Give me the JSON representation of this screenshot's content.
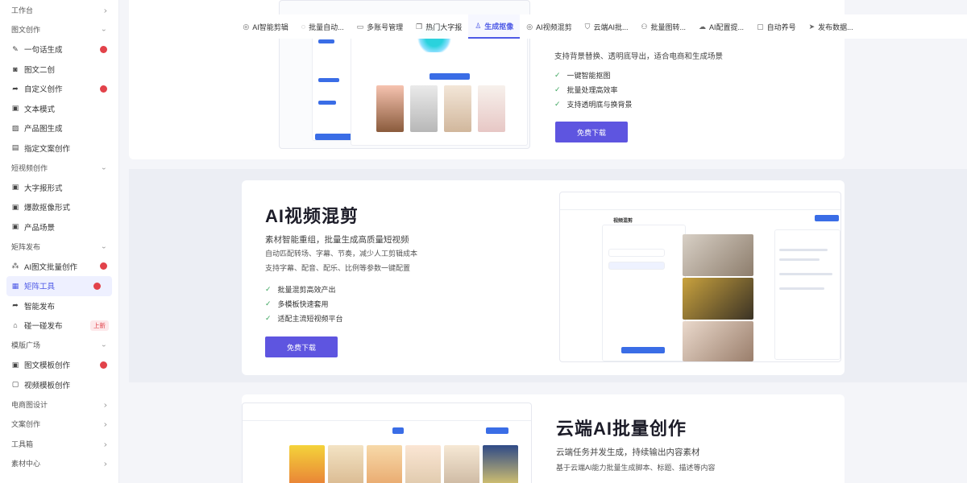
{
  "sidebar": {
    "sections": [
      {
        "label": "工作台",
        "items": []
      },
      {
        "label": "图文创作",
        "items": [
          {
            "label": "一句话生成",
            "icon": "pen-icon",
            "dot": true
          },
          {
            "label": "图文二创",
            "icon": "camera-icon",
            "dot": false
          },
          {
            "label": "自定义创作",
            "icon": "share-icon",
            "dot": true
          },
          {
            "label": "文本模式",
            "icon": "doc-icon",
            "dot": false
          },
          {
            "label": "产品图生成",
            "icon": "image-icon",
            "dot": false
          },
          {
            "label": "指定文案创作",
            "icon": "file-icon",
            "dot": false
          }
        ]
      },
      {
        "label": "短视频创作",
        "items": [
          {
            "label": "大字报形式",
            "icon": "doc-icon",
            "dot": false
          },
          {
            "label": "爆款抠像形式",
            "icon": "doc-icon",
            "dot": false
          },
          {
            "label": "产品场景",
            "icon": "doc-icon",
            "dot": false
          }
        ]
      },
      {
        "label": "矩阵发布",
        "items": [
          {
            "label": "AI图文批量创作",
            "icon": "tree-icon",
            "dot": true
          },
          {
            "label": "矩阵工具",
            "icon": "grid-icon",
            "dot": true,
            "active": true
          },
          {
            "label": "智能发布",
            "icon": "share-icon",
            "dot": false
          },
          {
            "label": "碰一碰发布",
            "icon": "home-icon",
            "badge": "上新"
          }
        ]
      },
      {
        "label": "模版广场",
        "items": [
          {
            "label": "图文模板创作",
            "icon": "doc-icon",
            "dot": true
          },
          {
            "label": "视频模板创作",
            "icon": "video-icon",
            "dot": false
          }
        ]
      },
      {
        "label": "电商图设计",
        "items": []
      },
      {
        "label": "文案创作",
        "items": []
      },
      {
        "label": "工具箱",
        "items": []
      },
      {
        "label": "素材中心",
        "items": []
      }
    ]
  },
  "tabs": [
    {
      "label": "AI智能剪辑",
      "icon": "check-circle-icon"
    },
    {
      "label": "批量自动...",
      "icon": "chat-icon"
    },
    {
      "label": "多账号管理",
      "icon": "monitor-icon"
    },
    {
      "label": "热门大字报",
      "icon": "copy-icon"
    },
    {
      "label": "生成抠像",
      "icon": "user-icon",
      "active": true
    },
    {
      "label": "AI视频混剪",
      "icon": "check-circle-icon"
    },
    {
      "label": "云端AI批...",
      "icon": "shield-icon"
    },
    {
      "label": "批量图转...",
      "icon": "nodes-icon"
    },
    {
      "label": "AI配置提...",
      "icon": "cloud-icon"
    },
    {
      "label": "自动养号",
      "icon": "box-icon"
    },
    {
      "label": "发布数据...",
      "icon": "send-icon"
    }
  ],
  "feature_top": {
    "subtitle": "支持背景替换、透明底导出，适合电商和生成场景",
    "list": [
      "一键智能抠图",
      "批量处理高效率",
      "支持透明底与换背景"
    ],
    "button": "免费下载"
  },
  "feature_mix": {
    "title": "AI视频混剪",
    "subtitle": "素材智能重组，批量生成高质量短视频",
    "desc": [
      "自动匹配转场、字幕、节奏，减少人工剪辑成本",
      "支持字幕、配音、配乐、比例等参数一键配置"
    ],
    "list": [
      "批量混剪高效产出",
      "多模板快速套用",
      "适配主流短视频平台"
    ],
    "button": "免费下载",
    "mock_title": "视频混剪"
  },
  "feature_cloud": {
    "title": "云端AI批量创作",
    "subtitle": "云端任务并发生成，持续输出内容素材",
    "desc": [
      "基于云端AI能力批量生成脚本、标题、描述等内容"
    ]
  },
  "colors": {
    "accent": "#4d59e6",
    "button": "#5e55e0",
    "check": "#3ba55d",
    "dot": "#e2424a"
  }
}
